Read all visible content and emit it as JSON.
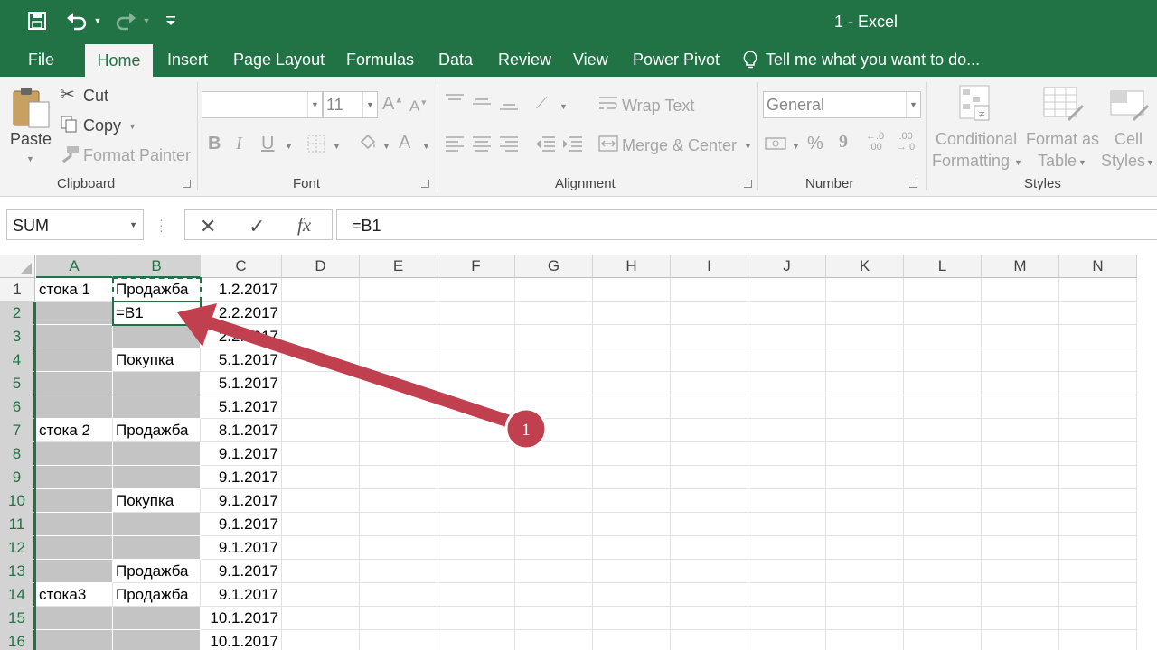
{
  "window": {
    "title": "1 - Excel"
  },
  "quick_access": {
    "save_icon": "save-icon",
    "undo_icon": "undo-icon",
    "redo_icon": "redo-icon",
    "customize_icon": "customize-qat-icon"
  },
  "tabs": [
    {
      "label": "File"
    },
    {
      "label": "Home",
      "active": true
    },
    {
      "label": "Insert"
    },
    {
      "label": "Page Layout"
    },
    {
      "label": "Formulas"
    },
    {
      "label": "Data"
    },
    {
      "label": "Review"
    },
    {
      "label": "View"
    },
    {
      "label": "Power Pivot"
    },
    {
      "label": "Tell me what you want to do..."
    }
  ],
  "ribbon": {
    "clipboard": {
      "paste": "Paste",
      "cut": "Cut",
      "copy": "Copy",
      "format_painter": "Format Painter",
      "label": "Clipboard"
    },
    "font": {
      "font_name": "",
      "font_size": "11",
      "label": "Font",
      "bold": "B",
      "italic": "I",
      "underline": "U"
    },
    "alignment": {
      "wrap_text": "Wrap Text",
      "merge_center": "Merge & Center",
      "label": "Alignment"
    },
    "number": {
      "format": "General",
      "label": "Number",
      "percent": "%",
      "comma": "9"
    },
    "styles": {
      "conditional_1": "Conditional",
      "conditional_2": "Formatting",
      "format_as_1": "Format as",
      "format_as_2": "Table",
      "cell_1": "Cell",
      "cell_2": "Styles",
      "label": "Styles"
    }
  },
  "formula_bar": {
    "name_box": "SUM",
    "formula": "=B1",
    "fx": "fx"
  },
  "grid": {
    "columns": [
      "A",
      "B",
      "C",
      "D",
      "E",
      "F",
      "G",
      "H",
      "I",
      "J",
      "K",
      "L",
      "M",
      "N"
    ],
    "rows": [
      "1",
      "2",
      "3",
      "4",
      "5",
      "6",
      "7",
      "8",
      "9",
      "10",
      "11",
      "12",
      "13",
      "14",
      "15",
      "16"
    ],
    "cells": [
      {
        "a": "стока 1",
        "b": "Продажба",
        "c": "1.2.2017"
      },
      {
        "a": "",
        "b": "=B1",
        "c": "2.2.2017"
      },
      {
        "a": "",
        "b": "",
        "c": "2.2.2017"
      },
      {
        "a": "",
        "b": "Покупка",
        "c": "5.1.2017"
      },
      {
        "a": "",
        "b": "",
        "c": "5.1.2017"
      },
      {
        "a": "",
        "b": "",
        "c": "5.1.2017"
      },
      {
        "a": "стока 2",
        "b": "Продажба",
        "c": "8.1.2017"
      },
      {
        "a": "",
        "b": "",
        "c": "9.1.2017"
      },
      {
        "a": "",
        "b": "",
        "c": "9.1.2017"
      },
      {
        "a": "",
        "b": "Покупка",
        "c": "9.1.2017"
      },
      {
        "a": "",
        "b": "",
        "c": "9.1.2017"
      },
      {
        "a": "",
        "b": "",
        "c": "9.1.2017"
      },
      {
        "a": "",
        "b": "Продажба",
        "c": "9.1.2017"
      },
      {
        "a": "стока3",
        "b": "Продажба",
        "c": "9.1.2017"
      },
      {
        "a": "",
        "b": "",
        "c": "10.1.2017"
      },
      {
        "a": "",
        "b": "",
        "c": "10.1.2017"
      }
    ]
  },
  "annotation": {
    "marker": "1",
    "color": "#c0404f"
  },
  "colors": {
    "accent": "#217346",
    "selection_fill": "#c4c4c4"
  }
}
